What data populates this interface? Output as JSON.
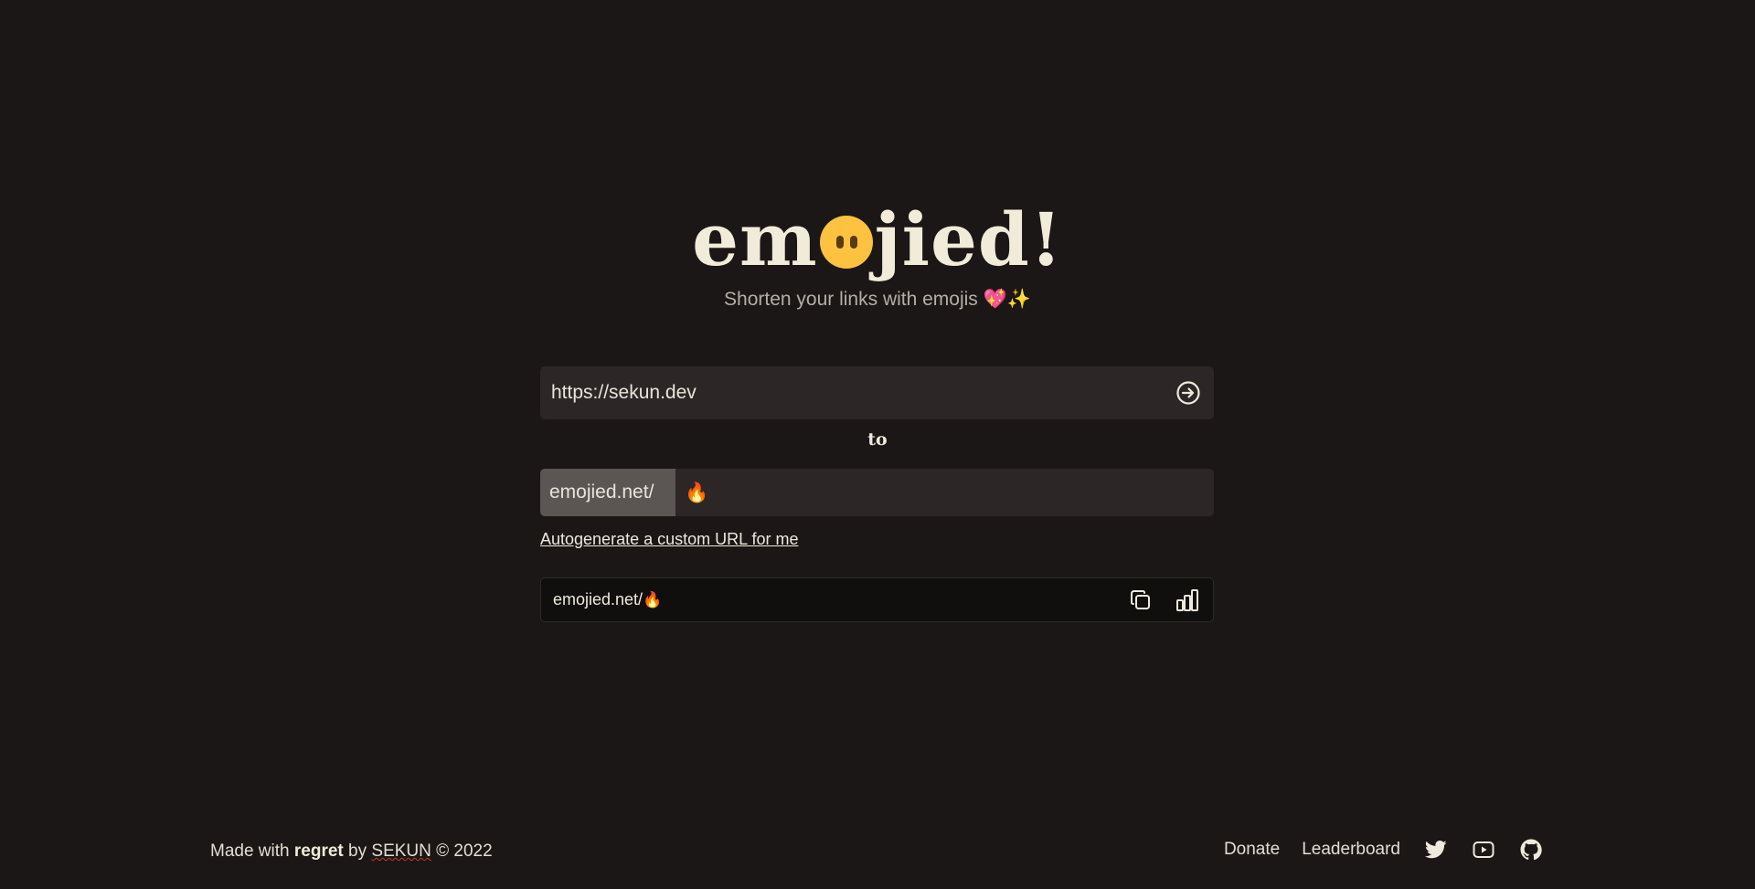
{
  "logo": {
    "text_before": "em",
    "text_after": "jied!"
  },
  "tagline": "Shorten your links with emojis 💖✨",
  "url_input": {
    "value": "https://sekun.dev"
  },
  "to_label": "to",
  "slug": {
    "prefix": "emojied.net/",
    "value": "🔥"
  },
  "autogenerate_link": "Autogenerate a custom URL for me",
  "result": {
    "text": "emojied.net/",
    "emoji": "🔥"
  },
  "footer": {
    "made_with": "Made with",
    "regret": "regret",
    "by": "by",
    "author": "SEKUN",
    "copyright": "© 2022",
    "links": {
      "donate": "Donate",
      "leaderboard": "Leaderboard"
    },
    "icons": [
      "twitter-icon",
      "youtube-icon",
      "github-icon"
    ]
  },
  "colors": {
    "background": "#1b1716",
    "input_bg": "#2c2726",
    "prefix_bg": "#5b5653",
    "logo_text": "#f1ecd9",
    "emoji_face": "#fdc23f"
  }
}
